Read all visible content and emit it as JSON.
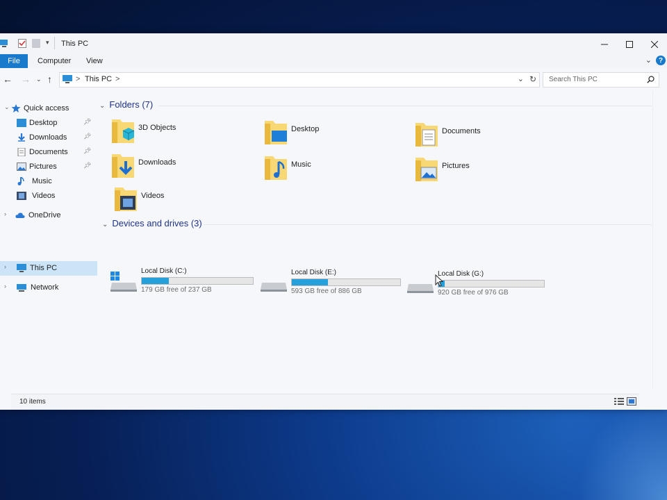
{
  "window": {
    "title": "This PC"
  },
  "ribbon": {
    "tabs": [
      "File",
      "Computer",
      "View"
    ],
    "help": "?"
  },
  "address": {
    "path": "This PC",
    "separator": ">",
    "search_placeholder": "Search This PC"
  },
  "nav": {
    "quick_access": "Quick access",
    "quick_items": [
      "Desktop",
      "Downloads",
      "Documents",
      "Pictures",
      "Music",
      "Videos"
    ],
    "onedrive": "OneDrive",
    "this_pc": "This PC",
    "network": "Network"
  },
  "folders": {
    "header": "Folders (7)",
    "items": [
      {
        "label": "3D Objects",
        "icon": "3d-objects-icon"
      },
      {
        "label": "Desktop",
        "icon": "desktop-icon"
      },
      {
        "label": "Documents",
        "icon": "documents-icon"
      },
      {
        "label": "Downloads",
        "icon": "downloads-icon"
      },
      {
        "label": "Music",
        "icon": "music-icon"
      },
      {
        "label": "Pictures",
        "icon": "pictures-icon"
      },
      {
        "label": "Videos",
        "icon": "videos-icon"
      }
    ]
  },
  "drives": {
    "header": "Devices and drives (3)",
    "items": [
      {
        "name": "Local Disk (C:)",
        "free_text": "179 GB free of 237 GB",
        "used_fraction": 0.245
      },
      {
        "name": "Local Disk (E:)",
        "free_text": "593 GB free of 886 GB",
        "used_fraction": 0.331
      },
      {
        "name": "Local Disk (G:)",
        "free_text": "920 GB free of 976 GB",
        "used_fraction": 0.057
      }
    ]
  },
  "status": {
    "items": "10 items"
  },
  "colors": {
    "accent": "#1979ca",
    "bar_fill": "#26a0da",
    "folder_yellow": "#f8d775"
  }
}
